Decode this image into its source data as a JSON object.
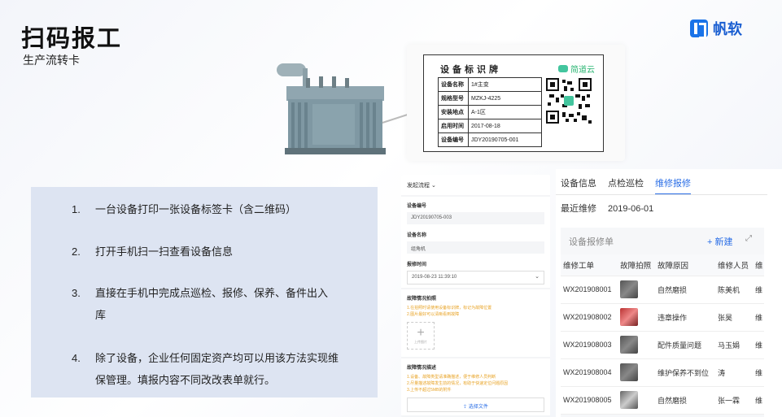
{
  "header": {
    "title": "扫码报工",
    "subtitle": "生产流转卡",
    "brand": "帆软"
  },
  "label_card": {
    "title": "设备标识牌",
    "brand": "简道云",
    "rows": [
      {
        "key": "设备名称",
        "value": "1#主变"
      },
      {
        "key": "规格型号",
        "value": "MZKJ-4225"
      },
      {
        "key": "安装地点",
        "value": "A-1区"
      },
      {
        "key": "启用时间",
        "value": "2017-08-18"
      },
      {
        "key": "设备编号",
        "value": "JDY20190705-001"
      }
    ]
  },
  "info": {
    "items": [
      {
        "num": "1.",
        "text": "一台设备打印一张设备标签卡（含二维码）"
      },
      {
        "num": "2.",
        "text": "打开手机扫一扫查看设备信息"
      },
      {
        "num": "3.",
        "text": "直接在手机中完成点巡检、报修、保养、备件出入库"
      },
      {
        "num": "4.",
        "text": "除了设备，企业任何固定资产均可以用该方法实现维保管理。填报内容不同改改表单就行。"
      }
    ]
  },
  "phone_form": {
    "header": "发起流程",
    "fields": [
      {
        "label": "设备编号",
        "value": "JDY20190705-003"
      },
      {
        "label": "设备名称",
        "value": "组角机"
      },
      {
        "label": "报修时间",
        "value": "2019-08-23 11:39:10"
      }
    ],
    "photo_label": "故障情况拍照",
    "photo_hints": [
      "1.在拍照时请使用设备标识牌，标记为故障位置",
      "2.图片最好可以清晰看到故障"
    ],
    "upload_caption": "上传图片",
    "desc_label": "故障情况描述",
    "desc_hints": [
      "1.设备、故障类型请准确描述，便于维修人员判断",
      "2.尽量描述故障发生前的情况，有助于快速定位问题原因",
      "3.上传不超过5MB的附件"
    ],
    "file_button": "选择文件"
  },
  "desktop": {
    "tabs": [
      "设备信息",
      "点检巡检",
      "维修报修"
    ],
    "active_tab": 2,
    "recent_label": "最近维修",
    "recent_value": "2019-06-01",
    "grid_title": "设备报修单",
    "new_button": "+ 新建",
    "columns": [
      "维修工单",
      "故障拍照",
      "故障原因",
      "维修人员",
      "维"
    ],
    "rows": [
      {
        "order": "WX201908001",
        "reason": "自然磨损",
        "person": "陈美机",
        "extra": "维"
      },
      {
        "order": "WX201908002",
        "reason": "违章操作",
        "person": "张昊",
        "extra": "维"
      },
      {
        "order": "WX201908003",
        "reason": "配件质量问题",
        "person": "马玉娟",
        "extra": "维"
      },
      {
        "order": "WX201908004",
        "reason": "维护保养不到位",
        "person": "涛",
        "extra": "维"
      },
      {
        "order": "WX201908005",
        "reason": "自然磨损",
        "person": "张一霖",
        "extra": "维"
      }
    ]
  },
  "colors": {
    "accent": "#2a6ee6",
    "panel": "#dde4f2",
    "warning": "#e8a325",
    "brand_green": "#2bb673"
  }
}
